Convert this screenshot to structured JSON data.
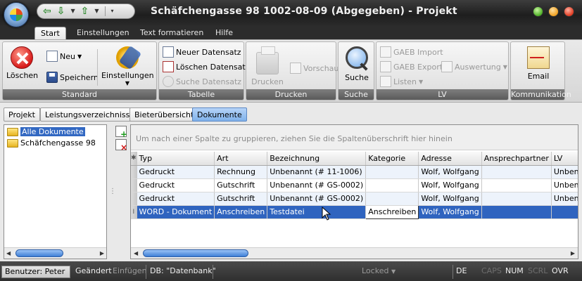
{
  "window": {
    "title": "Schäfchengasse 98 1002-08-09 (Abgegeben) - Projekt"
  },
  "ribbon_tabs": [
    "Start",
    "Einstellungen",
    "Text formatieren",
    "Hilfe"
  ],
  "ribbon": {
    "standard": {
      "label": "Standard",
      "delete": "Löschen",
      "new": "Neu",
      "save": "Speichern",
      "settings": "Einstellungen"
    },
    "tabelle": {
      "label": "Tabelle",
      "new_record": "Neuer Datensatz",
      "delete_record": "Löschen Datensatz",
      "search_record": "Suche Datensatz"
    },
    "drucken": {
      "label": "Drucken",
      "print": "Drucken",
      "preview": "Vorschau"
    },
    "suche": {
      "label": "Suche",
      "search": "Suche"
    },
    "lv": {
      "label": "LV",
      "gaeb_import": "GAEB Import",
      "gaeb_export": "GAEB Export",
      "lists": "Listen",
      "evaluation": "Auswertung"
    },
    "kommunikation": {
      "label": "Kommunikation",
      "email": "Email"
    }
  },
  "sub_tabs": [
    "Projekt",
    "Leistungsverzeichnisse",
    "Bieterübersicht",
    "Dokumente"
  ],
  "tree": {
    "items": [
      "Alle Dokumente",
      "Schäfchengasse 98"
    ]
  },
  "grid": {
    "group_hint": "Um nach einer Spalte zu gruppieren, ziehen Sie die Spaltenüberschrift hier hinein",
    "columns": [
      "Typ",
      "Art",
      "Bezeichnung",
      "Kategorie",
      "Adresse",
      "Ansprechpartner",
      "LV"
    ],
    "rows": [
      [
        "Gedruckt",
        "Rechnung",
        "Unbenannt (# 11-1006)",
        "",
        "Wolf, Wolfgang",
        "",
        "Unbenannt"
      ],
      [
        "Gedruckt",
        "Gutschrift",
        "Unbenannt (# GS-0002)",
        "",
        "Wolf, Wolfgang",
        "",
        "Unbenannt"
      ],
      [
        "Gedruckt",
        "Gutschrift",
        "Unbenannt (# GS-0002)",
        "",
        "Wolf, Wolfgang",
        "",
        "Unbenannt"
      ],
      [
        "WORD - Dokument",
        "Anschreiben",
        "Testdatei",
        "Anschreiben",
        "Wolf, Wolfgang",
        "",
        ""
      ]
    ]
  },
  "status": {
    "user": "Benutzer: Peter",
    "changed": "Geändert",
    "insert": "Einfügen",
    "db": "DB: \"Datenbank\"",
    "locked": "Locked",
    "lang": "DE",
    "caps": "CAPS",
    "num": "NUM",
    "scrl": "SCRL",
    "ovr": "OVR"
  }
}
